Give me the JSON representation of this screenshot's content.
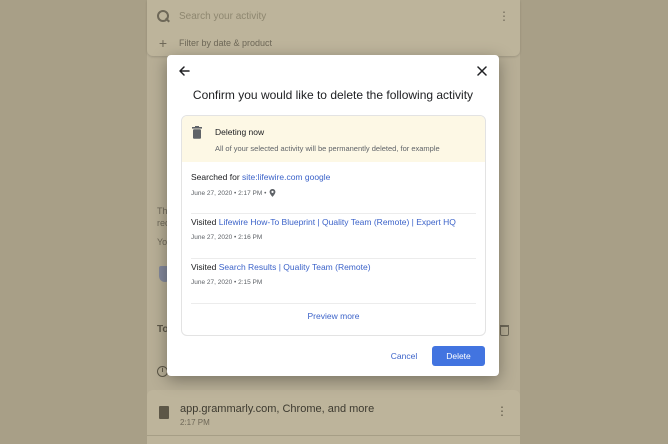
{
  "background": {
    "search_placeholder": "Search your activity",
    "filter_label": "Filter by date & product",
    "fragments": [
      "Th",
      "rec",
      "Yo"
    ],
    "section_label": "To",
    "item": {
      "title": "app.grammarly.com, Chrome, and more",
      "time": "2:17 PM"
    }
  },
  "modal": {
    "title": "Confirm you would like to delete the following activity",
    "banner": {
      "title": "Deleting now",
      "subtitle": "All of your selected activity will be permanently deleted, for example"
    },
    "activities": [
      {
        "prefix": "Searched for",
        "link": "site:lifewire.com google",
        "meta": "June 27, 2020 • 2:17 PM •",
        "has_location": true
      },
      {
        "prefix": "Visited",
        "link": "Lifewire How-To Blueprint | Quality Team (Remote) | Expert HQ",
        "meta": "June 27, 2020 • 2:16 PM",
        "has_location": false
      },
      {
        "prefix": "Visited",
        "link": "Search Results | Quality Team (Remote)",
        "meta": "June 27, 2020 • 2:15 PM",
        "has_location": false
      }
    ],
    "preview_more": "Preview more",
    "cancel_label": "Cancel",
    "delete_label": "Delete"
  },
  "colors": {
    "accent": "#4274e0",
    "link": "#3c63c9",
    "banner": "#fdf8e5",
    "overlay": "#a89f87"
  },
  "icons": {
    "back": "arrow-left-icon",
    "close": "close-icon",
    "trash": "trash-icon",
    "location": "location-pin-icon",
    "search": "search-icon",
    "more": "more-vert-icon"
  }
}
